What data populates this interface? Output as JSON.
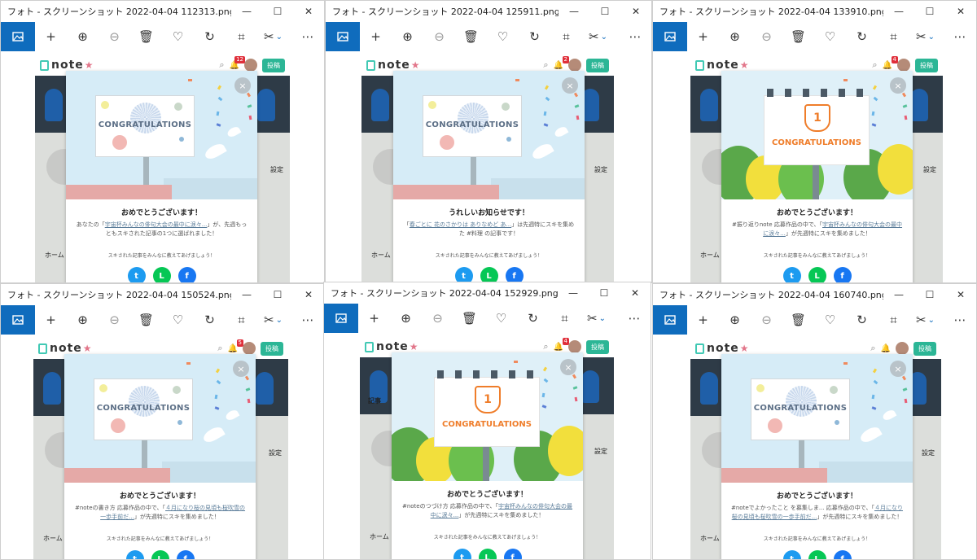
{
  "toolbar": {
    "icons": [
      "photo-icon",
      "add-icon",
      "zoom-in-icon",
      "zoom-out-icon",
      "delete-icon",
      "favorite-icon",
      "rotate-icon",
      "crop-icon",
      "edit-icon",
      "more-icon"
    ]
  },
  "app": {
    "logo": "note",
    "post_button": "投稿",
    "close_glyph": "×",
    "billboard_text": "CONGRATULATIONS",
    "share_prompt": "スキされた記事をみんなに教えてあげましょう！",
    "home_tab": "ホーム",
    "settings": "設定",
    "article_list": "記事"
  },
  "windows": [
    {
      "title": "フォト - スクリーンショット 2022-04-04 112313.png",
      "notif": "12",
      "art": "billboard",
      "modal_title": "おめでとうございます！",
      "desc_pre": "あなたの「",
      "desc_link": "宇宙杯みんなの俳句大会の最中に涙々...",
      "desc_post": "」が、先週もっともスキされた記事の1つに選ばれました！"
    },
    {
      "title": "フォト - スクリーンショット 2022-04-04 125911.png",
      "notif": "2",
      "art": "billboard",
      "modal_title": "うれしいお知らせです！",
      "desc_pre": "「",
      "desc_link": "春ごとに 花のさかりは ありなめど あ...",
      "desc_post": "」は先週特にスキを集めた #料理 の記事です！"
    },
    {
      "title": "フォト - スクリーンショット 2022-04-04 133910.png",
      "notif": "4",
      "art": "trophy",
      "modal_title": "おめでとうございます！",
      "desc_pre": "#振り返りnote 応募作品の中で、「",
      "desc_link": "宇宙杯みんなの俳句大会の最中に涙々...",
      "desc_post": "」が先週特にスキを集めました！"
    },
    {
      "title": "フォト - スクリーンショット 2022-04-04 150524.png",
      "notif": "5",
      "art": "billboard",
      "modal_title": "おめでとうございます！",
      "desc_pre": "#noteの書き方 応募作品の中で、「",
      "desc_link": "４月になり桜の見頃も桜吹雪の一歩手前だ...",
      "desc_post": "」が先週特にスキを集めました！"
    },
    {
      "title": "フォト - スクリーンショット 2022-04-04 152929.png",
      "notif": "4",
      "art": "trophy",
      "modal_title": "おめでとうございます！",
      "desc_pre": "#noteのつづけ方 応募作品の中で、「",
      "desc_link": "宇宙杯みんなの俳句大会の最中に涙々...",
      "desc_post": "」が先週特にスキを集めました！"
    },
    {
      "title": "フォト - スクリーンショット 2022-04-04 160740.png",
      "notif": "",
      "art": "billboard",
      "modal_title": "おめでとうございます！",
      "desc_pre": "#noteでよかったこと を募集しま... 応募作品の中で、「",
      "desc_link": "４月になり桜の見頃も桜吹雪の一歩手前だ...",
      "desc_post": "」が先週特にスキを集めました！"
    }
  ],
  "colors": {
    "accent": "#0f6cbd",
    "note_green": "#2cb696",
    "twitter": "#1d9bf0",
    "line": "#06c755",
    "facebook": "#1877f2",
    "trophy_orange": "#ef7d2a"
  }
}
